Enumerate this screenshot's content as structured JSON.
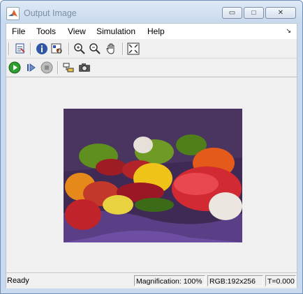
{
  "window": {
    "title": "Output Image"
  },
  "window_controls": {
    "minimize": "▭",
    "maximize": "□",
    "close": "✕"
  },
  "menu": {
    "items": [
      "File",
      "Tools",
      "View",
      "Simulation",
      "Help"
    ],
    "overflow_arrow": "↘"
  },
  "toolbar_icons": [
    "print-icon",
    "info-icon",
    "inspect-icon",
    "zoom-in-icon",
    "zoom-out-icon",
    "pan-hand-icon",
    "fit-to-view-icon"
  ],
  "sim_toolbar_icons": [
    "run-icon",
    "step-forward-icon",
    "stop-icon",
    "block-parameters-icon",
    "snapshot-camera-icon"
  ],
  "image": {
    "description_icon": "peppers-image"
  },
  "status": {
    "ready": "Ready",
    "magnification": "Magnification: 100%",
    "dimensions": "RGB:192x256",
    "time": "T=0.000"
  },
  "colors": {
    "titlebar": "#c9d9ee",
    "image_background": "#3e2a54",
    "run_green": "#2e9e2e"
  }
}
